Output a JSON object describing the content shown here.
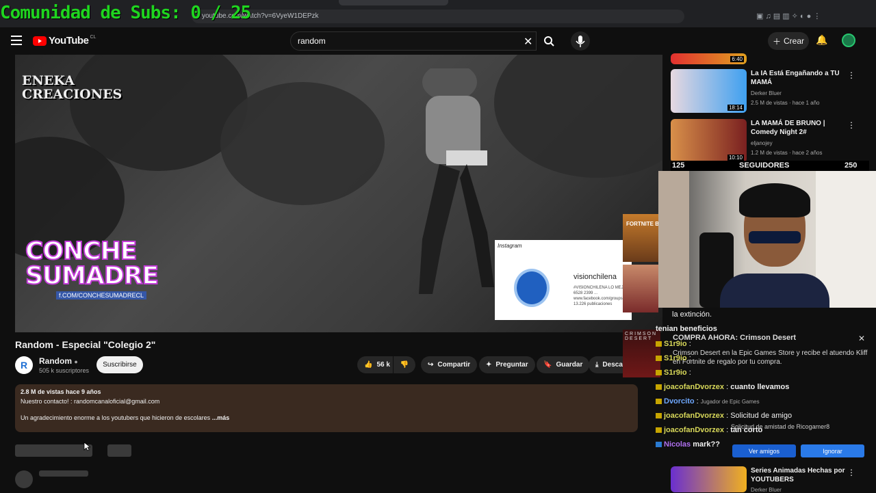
{
  "overlay": {
    "subs_counter": "Comunidad de Subs: 0 / 25"
  },
  "browser": {
    "url": "youtube.com/watch?v=6VyeW1DEPzk"
  },
  "header": {
    "logo_text": "YouTube",
    "country": "CL",
    "search_value": "random",
    "create_label": "Crear"
  },
  "player": {
    "watermark_top": "ENEKA\nCREACIONES",
    "logo_line1": "CONCHE",
    "logo_line2": "SUMADRE",
    "logo_fb": "f.COM/CONCHESUMADRECL",
    "insta_header": "Instagram",
    "insta_name": "visionchilena",
    "insta_desc": "#VISIONCHILENA LO MEJ... 6528 2399 ... www.facebook.com/groups ...",
    "insta_posts": "13.226 publicaciones",
    "fortnite_label": "FORTNITE BATTLE ROYA",
    "crimson_label": "CRIMSON DESERT"
  },
  "video": {
    "title": "Random - Especial \"Colegio 2\"",
    "channel_name": "Random",
    "channel_subs": "505 k suscriptores",
    "subscribe_label": "Suscribirse",
    "likes": "56 k",
    "share_label": "Compartir",
    "ask_label": "Preguntar",
    "save_label": "Guardar",
    "download_label": "Descargar"
  },
  "description": {
    "views_date": "2.8 M de vistas  hace 9 años",
    "contact": "Nuestro contacto! : randomcanaloficial@gmail.com",
    "text": "Un agradecimiento enorme a los youtubers que hicieron de escolares",
    "more": "...más"
  },
  "sidebar": {
    "videos": [
      {
        "title": "",
        "channel": "",
        "meta": "",
        "duration": "6:40"
      },
      {
        "title": "La IA Está Engañando a TU MAMÁ",
        "channel": "Derker Bluer",
        "meta": "2.5 M de vistas · hace 1 año",
        "duration": "18:14"
      },
      {
        "title": "LA MAMÁ DE BRUNO | Comedy Night 2#",
        "channel": "eljanojey",
        "meta": "1.2 M de vistas · hace 2 años",
        "duration": "10:10"
      },
      {
        "title": "Series Animadas Hechas por YOUTUBERS",
        "channel": "Derker Bluer",
        "meta": "",
        "duration": ""
      }
    ]
  },
  "stream": {
    "followers_current": "125",
    "followers_label": "SEGUIDORES",
    "followers_goal": "250",
    "chat_top": "la extinción.",
    "chat_beneficios": "tenian beneficios",
    "promo_title": "COMPRA AHORA: Crimson Desert",
    "promo_body": "Crimson Desert en la Epic Games Store y recibe el atuendo Kliff en Fortnite de regalo por tu compra.",
    "chat": [
      {
        "user": "S1r9io",
        "msg": ""
      },
      {
        "user": "S1r9io",
        "msg": ""
      },
      {
        "user": "S1r9io",
        "msg": ""
      },
      {
        "user": "joacofanDvorzex",
        "msg": "cuanto llevamos"
      },
      {
        "user": "Dvorcito",
        "msg": ""
      },
      {
        "user": "joacofanDvorzex",
        "msg": "Solicitud de amigo"
      },
      {
        "user": "joacofanDvorzex",
        "msg": "tan corto"
      },
      {
        "user": "Nicolas",
        "msg": "mark??"
      }
    ],
    "friend_request": "Solicitud de amistad de Ricogamer8",
    "epic_label": "Jugador de Epic Games",
    "view_friends": "Ver amigos",
    "ignore": "Ignorar"
  }
}
